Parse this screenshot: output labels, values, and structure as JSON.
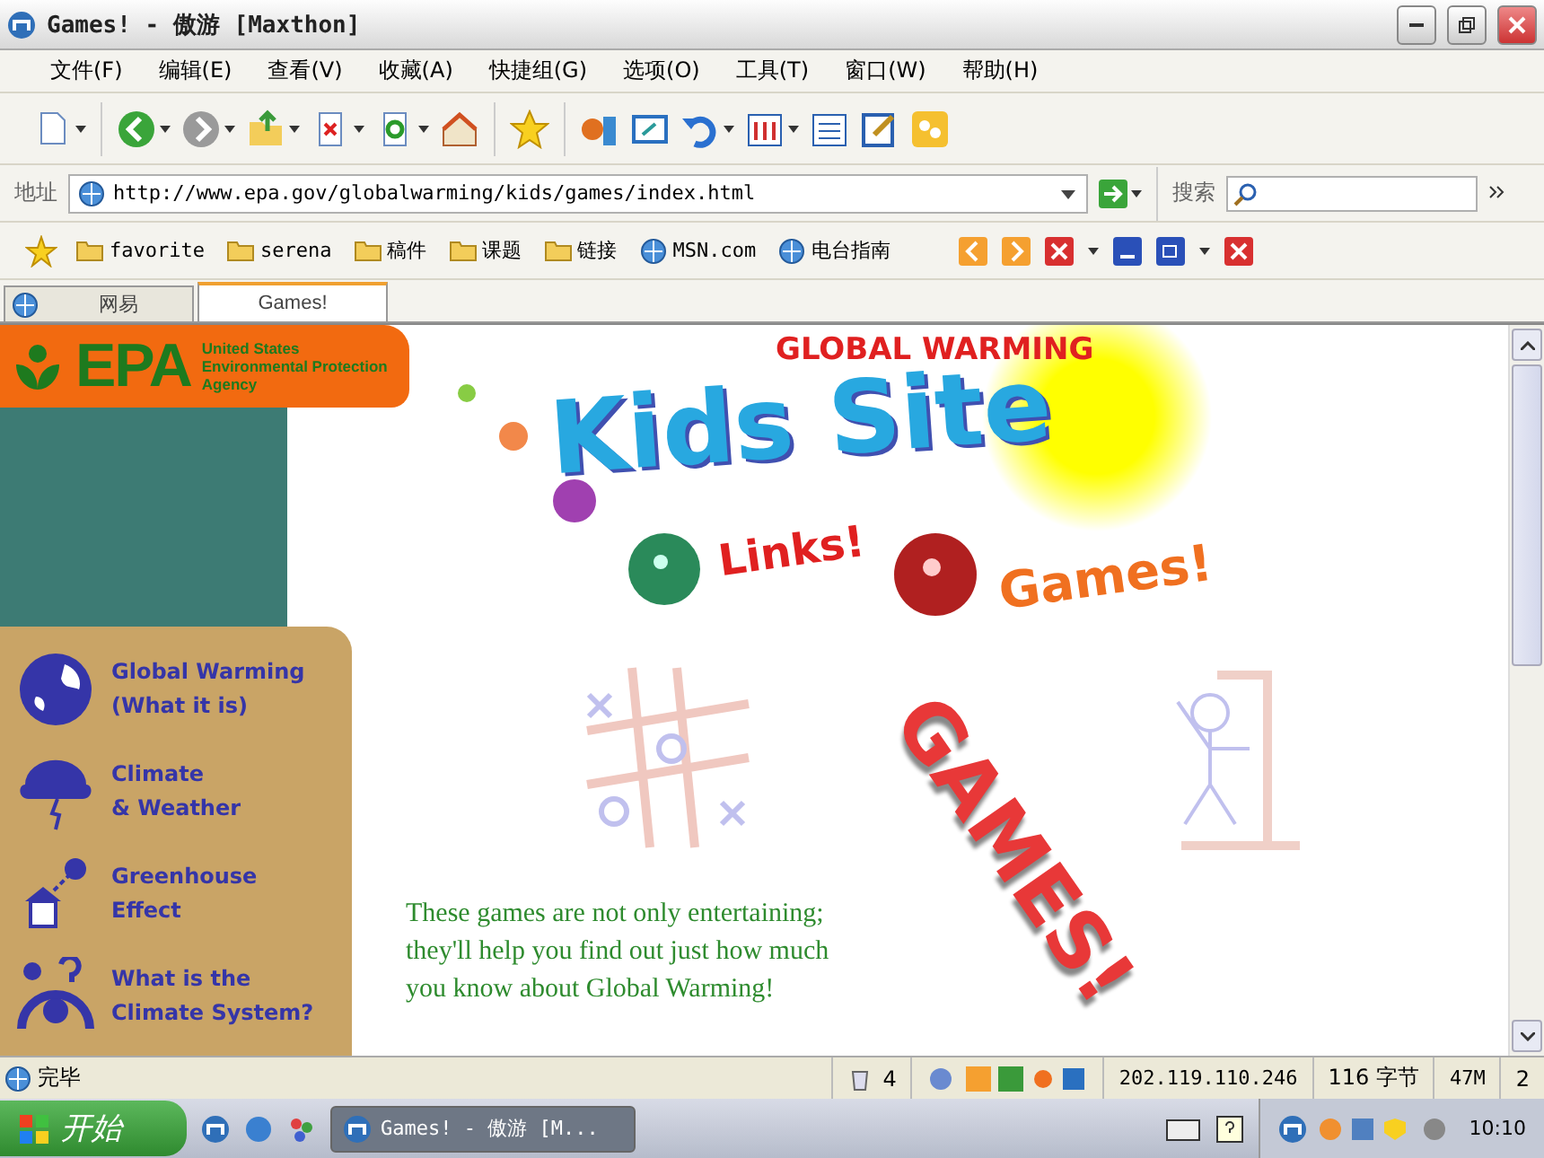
{
  "window": {
    "title": "Games! - 傲游 [Maxthon]"
  },
  "menu": [
    "文件(F)",
    "编辑(E)",
    "查看(V)",
    "收藏(A)",
    "快捷组(G)",
    "选项(O)",
    "工具(T)",
    "窗口(W)",
    "帮助(H)"
  ],
  "address": {
    "label": "地址",
    "url": "http://www.epa.gov/globalwarming/kids/games/index.html",
    "search_label": "搜索"
  },
  "favorites": [
    {
      "kind": "folder",
      "label": "favorite"
    },
    {
      "kind": "folder",
      "label": "serena"
    },
    {
      "kind": "folder",
      "label": "稿件"
    },
    {
      "kind": "folder",
      "label": "课题"
    },
    {
      "kind": "folder",
      "label": "链接"
    },
    {
      "kind": "page",
      "label": "MSN.com"
    },
    {
      "kind": "page",
      "label": "电台指南"
    }
  ],
  "tabs": [
    {
      "label": "网易",
      "selected": false
    },
    {
      "label": "Games!",
      "selected": true
    }
  ],
  "page": {
    "logo": {
      "mark": "EPA",
      "lines": [
        "United States",
        "Environmental Protection",
        "Agency"
      ]
    },
    "banner": {
      "kicker": "GLOBAL WARMING",
      "title": "Kids Site",
      "links": "Links!",
      "games": "Games!"
    },
    "nav": [
      {
        "kind": "globe",
        "lines": [
          "Global Warming",
          "(What it is)"
        ]
      },
      {
        "kind": "storm",
        "lines": [
          "Climate",
          "& Weather"
        ]
      },
      {
        "kind": "greenhouse",
        "lines": [
          "Greenhouse",
          "Effect"
        ]
      },
      {
        "kind": "system",
        "lines": [
          "What is the",
          "Climate System?"
        ]
      }
    ],
    "headline": "GAMES!",
    "intro": "These games are not only entertaining; they'll help you find out just how much you know about Global Warming!"
  },
  "status_bar": {
    "text": "完毕",
    "count": "4",
    "ip": "202.119.110.246",
    "size": "116 字节",
    "memory": "47M",
    "extra": "2"
  },
  "taskbar": {
    "start": "开始",
    "task": "Games! - 傲游 [M...",
    "clock": "10:10"
  }
}
